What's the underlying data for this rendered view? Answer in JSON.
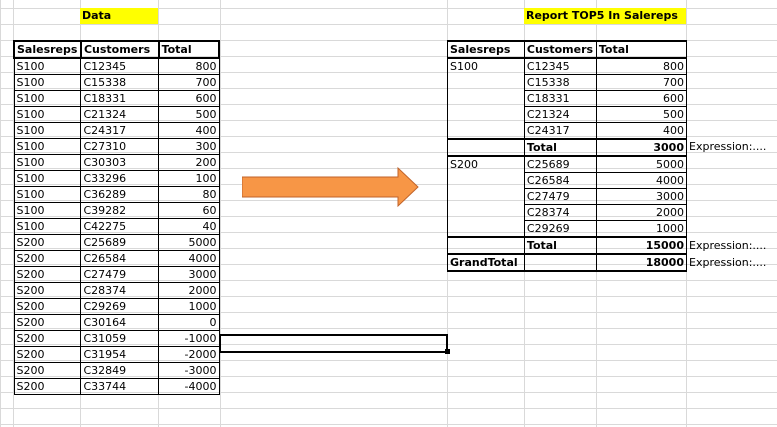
{
  "left": {
    "title": "Data",
    "headers": [
      "Salesreps",
      "Customers",
      "Total"
    ],
    "rows": [
      [
        "S100",
        "C12345",
        "800"
      ],
      [
        "S100",
        "C15338",
        "700"
      ],
      [
        "S100",
        "C18331",
        "600"
      ],
      [
        "S100",
        "C21324",
        "500"
      ],
      [
        "S100",
        "C24317",
        "400"
      ],
      [
        "S100",
        "C27310",
        "300"
      ],
      [
        "S100",
        "C30303",
        "200"
      ],
      [
        "S100",
        "C33296",
        "100"
      ],
      [
        "S100",
        "C36289",
        "80"
      ],
      [
        "S100",
        "C39282",
        "60"
      ],
      [
        "S100",
        "C42275",
        "40"
      ],
      [
        "S200",
        "C25689",
        "5000"
      ],
      [
        "S200",
        "C26584",
        "4000"
      ],
      [
        "S200",
        "C27479",
        "3000"
      ],
      [
        "S200",
        "C28374",
        "2000"
      ],
      [
        "S200",
        "C29269",
        "1000"
      ],
      [
        "S200",
        "C30164",
        "0"
      ],
      [
        "S200",
        "C31059",
        "-1000"
      ],
      [
        "S200",
        "C31954",
        "-2000"
      ],
      [
        "S200",
        "C32849",
        "-3000"
      ],
      [
        "S200",
        "C33744",
        "-4000"
      ]
    ]
  },
  "right": {
    "title": "Report TOP5 In Salereps",
    "headers": [
      "Salesreps",
      "Customers",
      "Total"
    ],
    "groups": [
      {
        "rep": "S100",
        "rows": [
          [
            "C12345",
            "800"
          ],
          [
            "C15338",
            "700"
          ],
          [
            "C18331",
            "600"
          ],
          [
            "C21324",
            "500"
          ],
          [
            "C24317",
            "400"
          ]
        ],
        "total_label": "Total",
        "total_value": "3000",
        "expression": "Expression:...."
      },
      {
        "rep": "S200",
        "rows": [
          [
            "C25689",
            "5000"
          ],
          [
            "C26584",
            "4000"
          ],
          [
            "C27479",
            "3000"
          ],
          [
            "C28374",
            "2000"
          ],
          [
            "C29269",
            "1000"
          ]
        ],
        "total_label": "Total",
        "total_value": "15000",
        "expression": "Expression:...."
      }
    ],
    "grand_label": "GrandTotal",
    "grand_value": "18000",
    "grand_expression": "Expression:...."
  },
  "arrow": {
    "color": "#f79646",
    "stroke": "#c0632a",
    "icon": "right-arrow-icon"
  }
}
